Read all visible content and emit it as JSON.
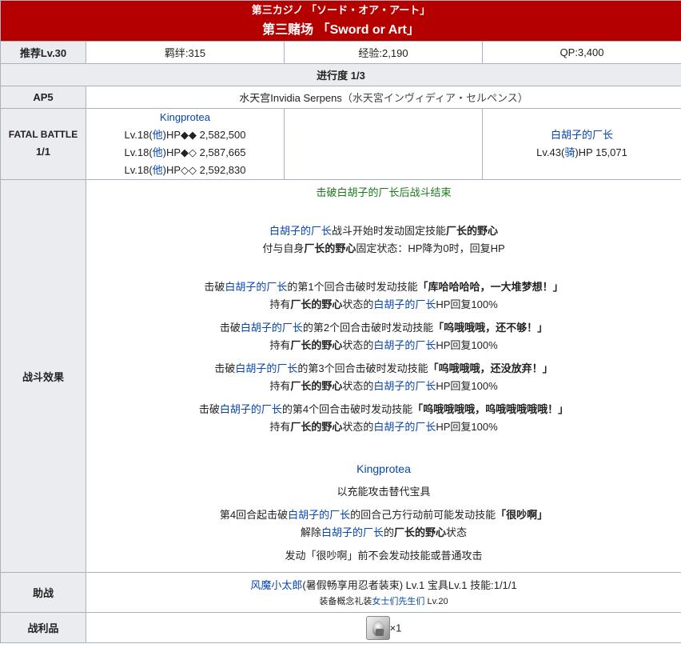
{
  "header": {
    "jp_title": "第三カジノ 「ソード・オア・アート」",
    "cn_title": "第三赌场 「Sword or Art」"
  },
  "info_row": {
    "label": "推荐Lv.30",
    "bond": "羁绊:315",
    "exp": "经验:2,190",
    "qp": "QP:3,400"
  },
  "progress": "进行度 1/3",
  "ap_row": {
    "label": "AP5",
    "location_link": "水天宫Invidia Serpens",
    "location_note": "（水天宮インヴィディア・セルペンス）"
  },
  "battle": {
    "label_line1": "FATAL BATTLE",
    "label_line2": "1/1",
    "enemy1": {
      "name": "Kingprotea",
      "lines": [
        {
          "pre": "Lv.18(",
          "cls": "他",
          "post": ")HP◆◆ 2,582,500"
        },
        {
          "pre": "Lv.18(",
          "cls": "他",
          "post": ")HP◆◇ 2,587,665"
        },
        {
          "pre": "Lv.18(",
          "cls": "他",
          "post": ")HP◇◇ 2,592,830"
        }
      ]
    },
    "enemy2": {
      "name": "白胡子的厂长",
      "pre": "Lv.43(",
      "cls": "骑",
      "post": ")HP 15,071"
    }
  },
  "effects": {
    "label": "战斗效果",
    "end_condition": "击破白胡子的厂长后战斗结束",
    "boss_name": "白胡子的厂长",
    "skill_name": "厂长的野心",
    "start_text": "战斗开始时发动固定技能",
    "grant_pre": "付与自身",
    "grant_post": "固定状态：HP降为0时，回复HP",
    "break_pre": "击破",
    "break_mid_pre": "的第",
    "break_mid_post": "个回合击破时发动技能",
    "holder_pre": "持有",
    "holder_mid": "状态的",
    "holder_post": "HP回复100%",
    "breaks": [
      {
        "n": "1",
        "skill": "「库哈哈哈哈，一大堆梦想！」"
      },
      {
        "n": "2",
        "skill": "「呜哦哦哦，还不够！」"
      },
      {
        "n": "3",
        "skill": "「呜哦哦哦，还没放弃！」"
      },
      {
        "n": "4",
        "skill": "「呜哦哦哦哦，呜哦哦哦哦哦！」"
      }
    ],
    "kp_name": "Kingprotea",
    "kp_line1": "以充能攻击替代宝具",
    "kp_line2_pre": "第4回合起击破",
    "kp_line2_post": "的回合己方行动前可能发动技能",
    "kp_line2_skill": "「很吵啊」",
    "kp_line3_pre": "解除",
    "kp_line3_mid": "的",
    "kp_line3_post": "状态",
    "kp_line4": "发动「很吵啊」前不会发动技能或普通攻击"
  },
  "support": {
    "label": "助战",
    "servant_link": "风魔小太郎",
    "servant_rest": "(暑假畅享用忍者装束) Lv.1 宝具Lv.1 技能:1/1/1",
    "ce_pre": "装备概念礼装",
    "ce_link": "女士们先生们",
    "ce_post": " Lv.20"
  },
  "drops": {
    "label": "战利品",
    "icon": "silver-material-icon",
    "count": "×1"
  }
}
